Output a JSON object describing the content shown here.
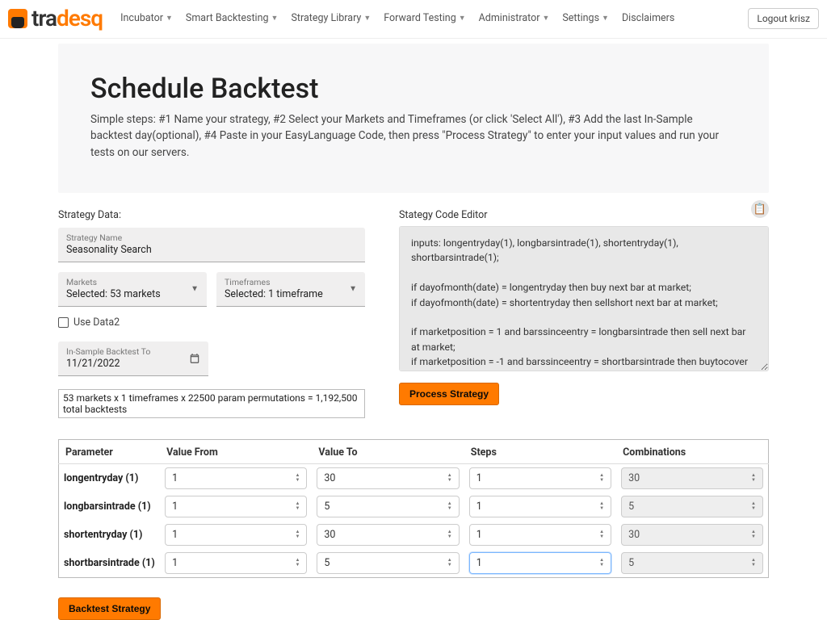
{
  "nav": {
    "brand_pre": "tra",
    "brand_mid": "desq",
    "items": [
      {
        "label": "Incubator",
        "dropdown": true
      },
      {
        "label": "Smart Backtesting",
        "dropdown": true
      },
      {
        "label": "Strategy Library",
        "dropdown": true
      },
      {
        "label": "Forward Testing",
        "dropdown": true
      },
      {
        "label": "Administrator",
        "dropdown": true
      },
      {
        "label": "Settings",
        "dropdown": true
      },
      {
        "label": "Disclaimers",
        "dropdown": false
      }
    ],
    "logout": "Logout krisz"
  },
  "hero": {
    "title": "Schedule Backtest",
    "blurb": "Simple steps: #1 Name your strategy, #2 Select your Markets and Timeframes (or click 'Select All'), #3 Add the last In-Sample backtest day(optional), #4 Paste in your EasyLanguage Code, then press \"Process Strategy\" to enter your input values and run your tests on our servers."
  },
  "strategy_data": {
    "header": "Strategy Data:",
    "name_label": "Strategy Name",
    "name_value": "Seasonality Search",
    "markets_label": "Markets",
    "markets_value": "Selected: 53 markets",
    "timeframes_label": "Timeframes",
    "timeframes_value": "Selected: 1 timeframe",
    "use_data2": "Use Data2",
    "insample_label": "In-Sample Backtest To",
    "insample_value": "11/21/2022",
    "summary": "53 markets x 1 timeframes x 22500 param permutations = 1,192,500 total backtests"
  },
  "code_editor": {
    "header": "Stategy Code Editor",
    "code": "inputs: longentryday(1), longbarsintrade(1), shortentryday(1), shortbarsintrade(1);\n\nif dayofmonth(date) = longentryday then buy next bar at market;\nif dayofmonth(date) = shortentryday then sellshort next bar at market;\n\nif marketposition = 1 and barssinceentry = longbarsintrade then sell next bar at market;\nif marketposition = -1 and barssinceentry = shortbarsintrade then buytocover next bar at market;",
    "process_btn": "Process Strategy"
  },
  "params": {
    "headers": [
      "Parameter",
      "Value From",
      "Value To",
      "Steps",
      "Combinations"
    ],
    "rows": [
      {
        "name": "longentryday (1)",
        "from": "1",
        "to": "30",
        "steps": "1",
        "comb": "30"
      },
      {
        "name": "longbarsintrade (1)",
        "from": "1",
        "to": "5",
        "steps": "1",
        "comb": "5"
      },
      {
        "name": "shortentryday (1)",
        "from": "1",
        "to": "30",
        "steps": "1",
        "comb": "30"
      },
      {
        "name": "shortbarsintrade (1)",
        "from": "1",
        "to": "5",
        "steps": "1",
        "comb": "5",
        "steps_focused": true
      }
    ]
  },
  "footer": {
    "backtest_btn": "Backtest Strategy"
  }
}
